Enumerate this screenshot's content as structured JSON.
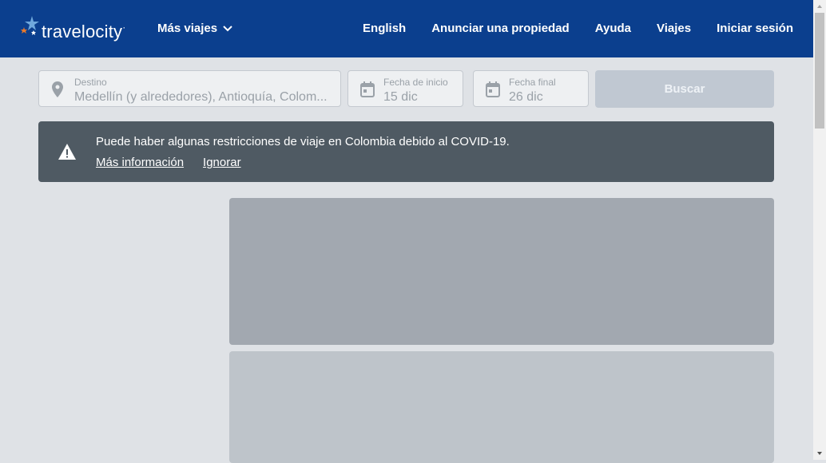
{
  "header": {
    "logo_text": "travelocity",
    "more_trips": "Más viajes",
    "nav": [
      "English",
      "Anunciar una propiedad",
      "Ayuda",
      "Viajes",
      "Iniciar sesión"
    ]
  },
  "search": {
    "destination_label": "Destino",
    "destination_value": "Medellín (y alrededores), Antioquía, Colom...",
    "start_label": "Fecha de inicio",
    "start_value": "15 dic",
    "end_label": "Fecha final",
    "end_value": "26 dic",
    "search_button": "Buscar"
  },
  "alert": {
    "message": "Puede haber algunas restricciones de viaje en Colombia debido al COVID-19.",
    "more_info": "Más información",
    "ignore": "Ignorar"
  },
  "colors": {
    "header_bg": "#0b3f8e",
    "alert_bg": "#4f5a63",
    "page_bg": "#dfe2e6"
  }
}
